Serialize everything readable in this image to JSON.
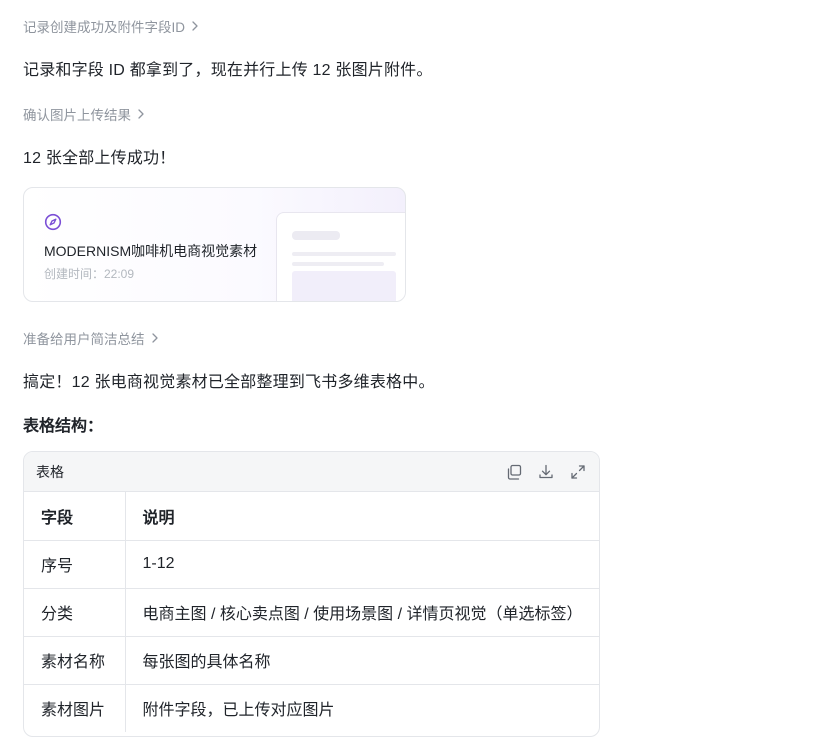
{
  "steps": {
    "step1": "记录创建成功及附件字段ID",
    "step2": "确认图片上传结果",
    "step3": "准备给用户简洁总结"
  },
  "messages": {
    "m1": "记录和字段 ID 都拿到了，现在并行上传 12 张图片附件。",
    "m2": "12 张全部上传成功！",
    "m3": "搞定！12 张电商视觉素材已全部整理到飞书多维表格中。",
    "table_heading": "表格结构："
  },
  "card": {
    "icon": "compass-icon",
    "title": "MODERNISM咖啡机电商视觉素材",
    "meta": "创建时间：22:09"
  },
  "table": {
    "label": "表格",
    "tools": [
      "copy-icon",
      "download-icon",
      "expand-icon"
    ],
    "headers": [
      "字段",
      "说明"
    ],
    "rows": [
      [
        "序号",
        "1-12"
      ],
      [
        "分类",
        "电商主图 / 核心卖点图 / 使用场景图 / 详情页视觉（单选标签）"
      ],
      [
        "素材名称",
        "每张图的具体名称"
      ],
      [
        "素材图片",
        "附件字段，已上传对应图片"
      ]
    ]
  },
  "colors": {
    "accent": "#7b4fd6",
    "muted": "#8f959e",
    "border": "#e4e6ea"
  }
}
